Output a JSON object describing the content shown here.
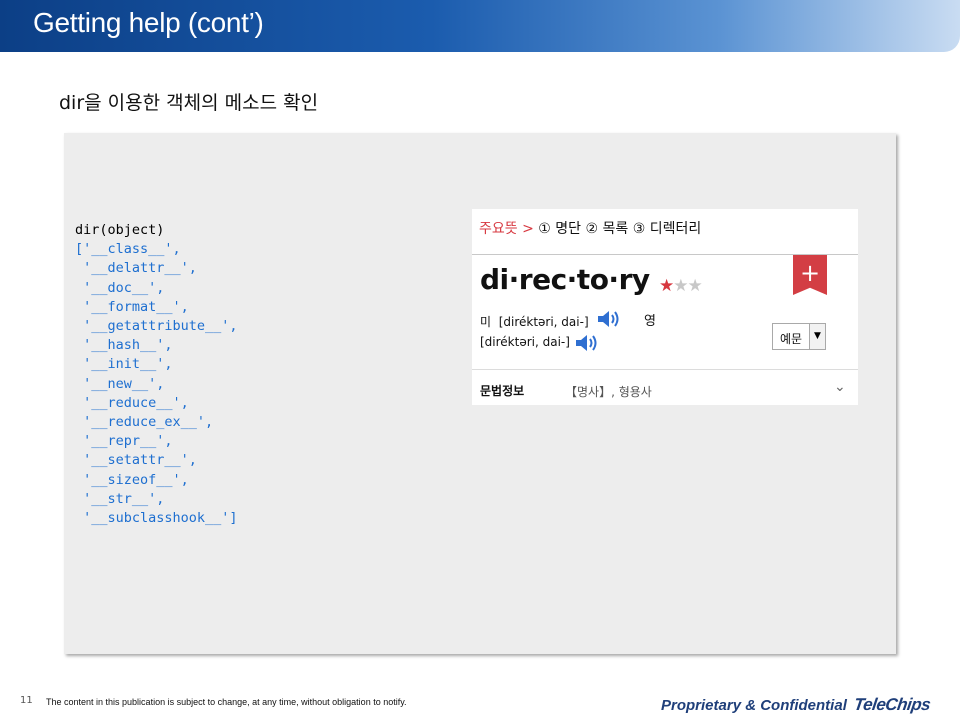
{
  "slide": {
    "title": "Getting help (cont’)",
    "subtitle": "dir을 이용한 객체의 메소드 확인",
    "page_number": "11",
    "disclaimer": "The content in this publication is subject to change, at any time, without obligation to notify.",
    "proprietary": "Proprietary & Confidential",
    "logo_text": "TeleChips"
  },
  "code": {
    "call": "dir(object)",
    "output_lines": [
      "['__class__',",
      " '__delattr__',",
      " '__doc__',",
      " '__format__',",
      " '__getattribute__',",
      " '__hash__',",
      " '__init__',",
      " '__new__',",
      " '__reduce__',",
      " '__reduce_ex__',",
      " '__repr__',",
      " '__setattr__',",
      " '__sizeof__',",
      " '__str__',",
      " '__subclasshook__']"
    ]
  },
  "dictionary": {
    "main_meaning_label": "주요뜻 >",
    "main_meaning_text": "① 명단 ② 목록 ③ 디렉터리",
    "headword": "di·rec·to·ry",
    "stars_filled": 1,
    "stars_total": 3,
    "stars_on_text": "★",
    "stars_off_text": "★★",
    "add_label": "+",
    "pron_us_label": "미",
    "pron_us": "[diréktəri, dai-]",
    "pron_uk_label": "영",
    "pron_uk": "[diréktəri, dai-]",
    "example_select": "예문",
    "select_arrow": "▼",
    "grammar_label": "문법정보",
    "grammar_value": "【명사】, 형용사",
    "expand_icon": "chevron-down-icon",
    "expand_glyph": "⌄"
  },
  "colors": {
    "title_bar": "#1b5cae",
    "code_blue": "#1e6fd0",
    "accent_red": "#d33e44",
    "panel_bg": "#ededed"
  }
}
